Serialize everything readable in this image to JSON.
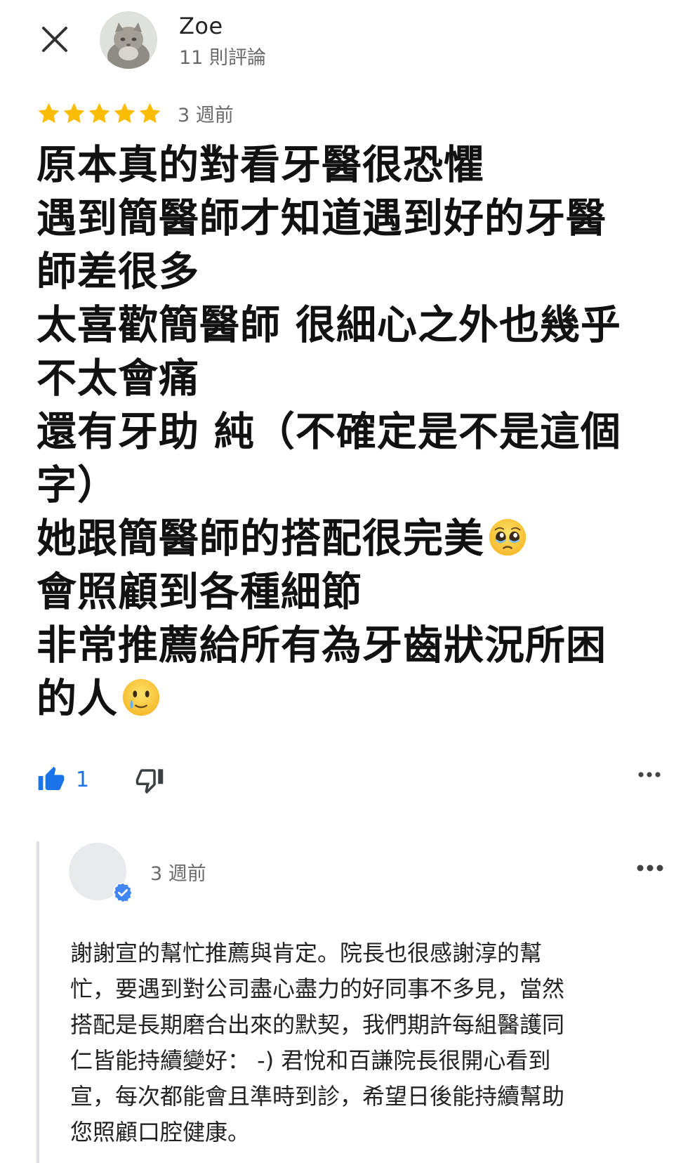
{
  "header": {
    "reviewer_name": "Zoe",
    "review_count": "11 則評論"
  },
  "review": {
    "rating": 5,
    "max_rating": 5,
    "time": "3 週前",
    "star_color": "#fbbc04",
    "lines": [
      "原本真的對看牙醫很恐懼",
      "遇到簡醫師才知道遇到好的牙醫",
      "師差很多",
      "太喜歡簡醫師 很細心之外也幾乎",
      "不太會痛",
      "還有牙助 純（不確定是不是這個",
      "字）",
      "她跟簡醫師的搭配很完美",
      "會照顧到各種細節",
      "非常推薦給所有為牙齒狀況所困",
      "的人"
    ],
    "emojis": {
      "line_7": "pleading-face-emoji",
      "line_10": "smiling-face-with-tear-emoji"
    }
  },
  "actions": {
    "like_count": "1",
    "like_color": "#1a73e8",
    "icons": [
      "thumbs-up-icon",
      "thumbs-down-icon",
      "more-icon"
    ]
  },
  "owner_reply": {
    "time": "3 週前",
    "badge_color": "#4285f4",
    "lines": [
      "謝謝宣的幫忙推薦與肯定。院長也很感謝淳的幫",
      "忙，要遇到對公司盡心盡力的好同事不多見，當然",
      "搭配是長期磨合出來的默契，我們期許每組醫護同",
      "仁皆能持續變好： -) 君悅和百謙院長很開心看到",
      "宣，每次都能會且準時到診，希望日後能持續幫助",
      "您照顧口腔健康。"
    ]
  }
}
